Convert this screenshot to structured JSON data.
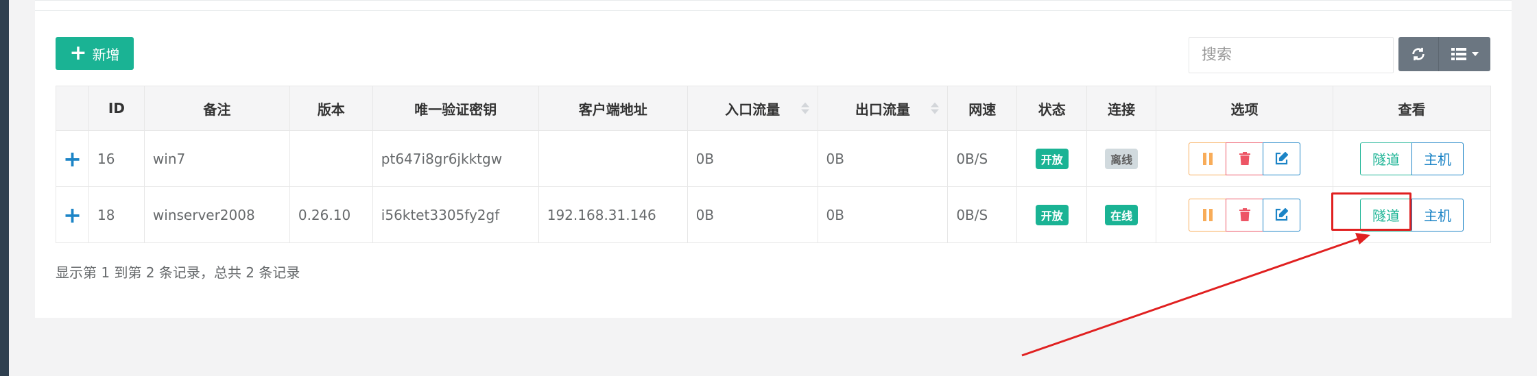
{
  "toolbar": {
    "add_label": "新增",
    "search_placeholder": "搜索"
  },
  "table": {
    "columns": [
      "",
      "ID",
      "备注",
      "版本",
      "唯一验证密钥",
      "客户端地址",
      "入口流量",
      "出口流量",
      "网速",
      "状态",
      "连接",
      "选项",
      "查看"
    ],
    "rows": [
      {
        "id": "16",
        "remark": "win7",
        "version": "",
        "key": "pt647i8gr6jkktgw",
        "client_addr": "",
        "in_flow": "0B",
        "out_flow": "0B",
        "speed": "0B/S",
        "status": "开放",
        "connection": "离线",
        "view_tunnel": "隧道",
        "view_host": "主机"
      },
      {
        "id": "18",
        "remark": "winserver2008",
        "version": "0.26.10",
        "key": "i56ktet3305fy2gf",
        "client_addr": "192.168.31.146",
        "in_flow": "0B",
        "out_flow": "0B",
        "speed": "0B/S",
        "status": "开放",
        "connection": "在线",
        "view_tunnel": "隧道",
        "view_host": "主机"
      }
    ],
    "expand_symbol": "+"
  },
  "footer": {
    "summary": "显示第 1 到第 2 条记录，总共 2 条记录"
  },
  "colors": {
    "primary": "#1ab394",
    "info": "#1c84c6",
    "warning": "#f8ac59",
    "danger": "#ed5565",
    "annotation": "#e02020"
  },
  "icons": [
    "plus-icon",
    "refresh-icon",
    "list-icon",
    "caret-down-icon",
    "pause-icon",
    "trash-icon",
    "edit-icon",
    "sort-icon"
  ]
}
